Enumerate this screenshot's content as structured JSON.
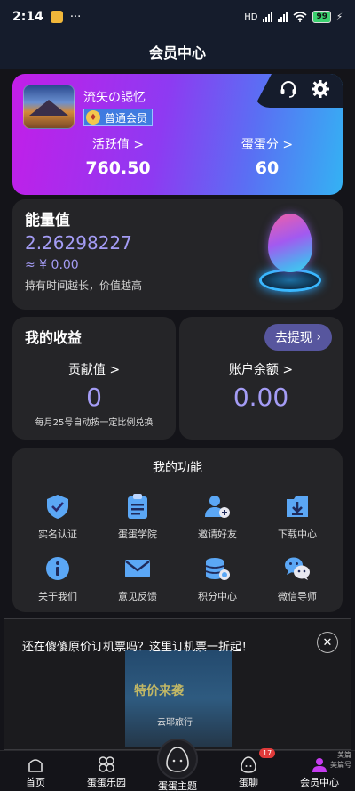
{
  "status": {
    "time": "2:14",
    "more": "···",
    "battery": "99",
    "network": "HD"
  },
  "header": {
    "title": "会员中心"
  },
  "card": {
    "username": "流矢の誋忆",
    "level": "普通会员",
    "active_label": "活跃值",
    "active_value": "760.50",
    "egg_label": "蛋蛋分",
    "egg_value": "60",
    "arrow": ">"
  },
  "energy": {
    "title": "能量值",
    "value": "2.26298227",
    "cny": "≈ ¥ 0.00",
    "desc": "持有时间越长，价值越高"
  },
  "income": {
    "title": "我的收益",
    "contribution_label": "贡献值",
    "contribution_value": "0",
    "note": "每月25号自动按一定比例兑换",
    "arrow": ">"
  },
  "balance": {
    "withdraw_label": "去提现",
    "withdraw_arrow": "›",
    "label": "账户余额",
    "value": "0.00",
    "arrow": ">"
  },
  "functions": {
    "title": "我的功能",
    "items": [
      {
        "label": "实名认证",
        "icon": "shield-check-icon"
      },
      {
        "label": "蛋蛋学院",
        "icon": "clipboard-icon"
      },
      {
        "label": "邀请好友",
        "icon": "add-user-icon"
      },
      {
        "label": "下载中心",
        "icon": "download-icon"
      },
      {
        "label": "关于我们",
        "icon": "info-icon"
      },
      {
        "label": "意见反馈",
        "icon": "mail-icon"
      },
      {
        "label": "积分中心",
        "icon": "coins-icon"
      },
      {
        "label": "微信导师",
        "icon": "wechat-icon"
      }
    ]
  },
  "ad": {
    "text": "还在傻傻原价订机票吗？这里订机票一折起！",
    "close": "✕",
    "banner_text": "特价来袭",
    "brand": "云耶旅行"
  },
  "tabbar": {
    "items": [
      {
        "label": "首页"
      },
      {
        "label": "蛋蛋乐园"
      },
      {
        "label": "蛋蛋主题"
      },
      {
        "label": "蛋聊",
        "badge": "17"
      },
      {
        "label": "会员中心"
      }
    ],
    "watermark_line1": "美篇",
    "watermark_line2": "美篇号"
  },
  "colors": {
    "accent": "#a49cf5",
    "card_gradient_start": "#c31ee8",
    "card_gradient_end": "#34b2f3",
    "panel": "#252528",
    "icon_blue": "#5ba7f5"
  }
}
